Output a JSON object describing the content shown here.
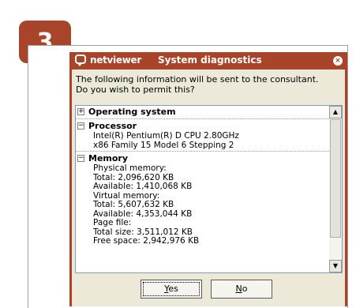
{
  "step_badge": "3",
  "dialog": {
    "logo": "netviewer",
    "title": "System diagnostics",
    "close_symbol": "×",
    "intro_line1": "The following information will be sent to the consultant.",
    "intro_line2": "Do you wish to permit this?"
  },
  "sections": {
    "os": {
      "toggle": "+",
      "title": "Operating system"
    },
    "processor": {
      "toggle": "−",
      "title": "Processor",
      "lines": [
        "Intel(R) Pentium(R) D CPU 2.80GHz",
        "x86 Family 15 Model 6 Stepping 2"
      ]
    },
    "memory": {
      "toggle": "−",
      "title": "Memory",
      "lines": [
        "Physical memory:",
        "Total:  2,096,620 KB",
        "Available:  1,410,068 KB",
        "Virtual memory:",
        "Total:  5,607,632 KB",
        "Available:  4,353,044 KB",
        "Page file:",
        "Total size:  3,511,012 KB",
        "Free space:  2,942,976 KB"
      ]
    }
  },
  "buttons": {
    "yes_mnemonic": "Y",
    "yes_rest": "es",
    "no_mnemonic": "N",
    "no_rest": "o"
  },
  "colors": {
    "accent": "#a8442a",
    "client": "#ece9d8"
  }
}
